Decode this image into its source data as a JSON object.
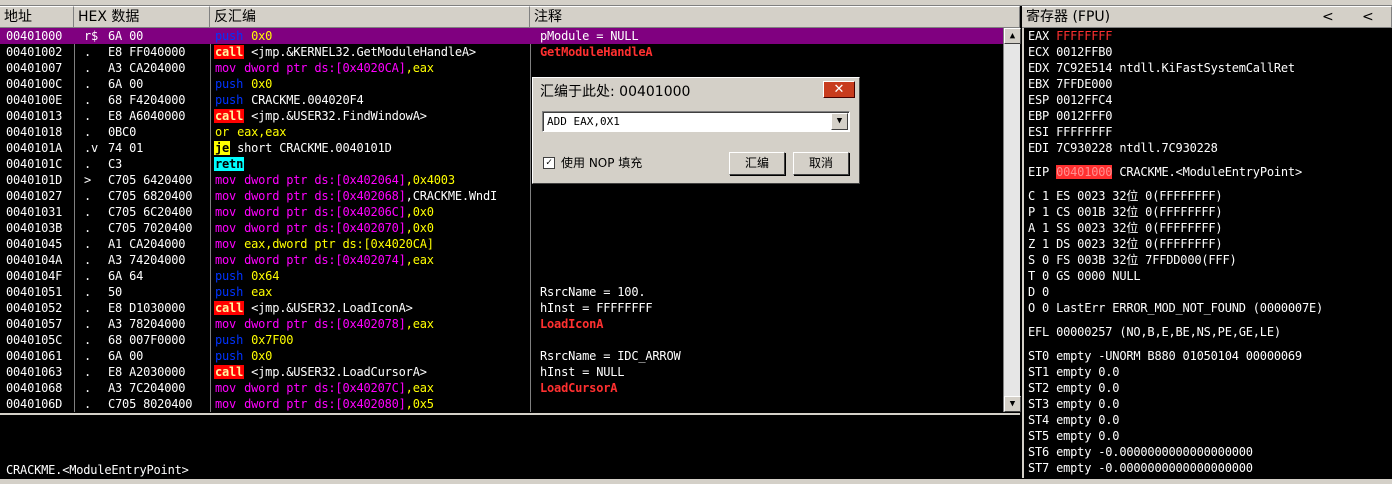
{
  "headers": {
    "address": "地址",
    "hex": "HEX 数据",
    "disasm": "反汇编",
    "comment": "注释",
    "registers": "寄存器 (FPU)",
    "reg_nav_left": "<",
    "reg_nav_right": "<"
  },
  "rows": [
    {
      "addr": "00401000",
      "mark": "r$",
      "hex": "6A 00",
      "asm": [
        {
          "t": "push",
          "c": "mnem-push"
        },
        {
          "t": " 0x0",
          "c": "num"
        }
      ],
      "cmt": "pModule = NULL",
      "sel": true
    },
    {
      "addr": "00401002",
      "mark": ".",
      "hex": "E8 FF040000",
      "asm": [
        {
          "t": "call",
          "c": "k-call"
        },
        {
          "t": " <jmp.&KERNEL32.GetModuleHandleA>",
          "c": "op"
        }
      ],
      "cmt": "GetModuleHandleA",
      "cmtApi": true
    },
    {
      "addr": "00401007",
      "mark": ".",
      "hex": "A3 CA204000",
      "asm": [
        {
          "t": "mov",
          "c": "mnem-mov"
        },
        {
          "t": " dword ptr ds:[0x4020CA]",
          "c": "ptr"
        },
        {
          "t": ",eax",
          "c": "num"
        }
      ],
      "cmt": ""
    },
    {
      "addr": "0040100C",
      "mark": ".",
      "hex": "6A 00",
      "asm": [
        {
          "t": "push",
          "c": "mnem-push"
        },
        {
          "t": " 0x0",
          "c": "num"
        }
      ],
      "cmt": ""
    },
    {
      "addr": "0040100E",
      "mark": ".",
      "hex": "68 F4204000",
      "asm": [
        {
          "t": "push",
          "c": "mnem-push"
        },
        {
          "t": " CRACKME.004020F4",
          "c": "op"
        }
      ],
      "cmt": ""
    },
    {
      "addr": "00401013",
      "mark": ".",
      "hex": "E8 A6040000",
      "asm": [
        {
          "t": "call",
          "c": "k-call"
        },
        {
          "t": " <jmp.&USER32.FindWindowA>",
          "c": "op"
        }
      ],
      "cmt": ""
    },
    {
      "addr": "00401018",
      "mark": ".",
      "hex": "0BC0",
      "asm": [
        {
          "t": "or",
          "c": "mnem-or"
        },
        {
          "t": " eax,eax",
          "c": "num"
        }
      ],
      "cmt": ""
    },
    {
      "addr": "0040101A",
      "mark": ".v",
      "hex": "74 01",
      "asm": [
        {
          "t": "je",
          "c": "k-je"
        },
        {
          "t": " short CRACKME.0040101D",
          "c": "op"
        }
      ],
      "cmt": ""
    },
    {
      "addr": "0040101C",
      "mark": ".",
      "hex": "C3",
      "asm": [
        {
          "t": "retn",
          "c": "k-retn"
        }
      ],
      "cmt": ""
    },
    {
      "addr": "0040101D",
      "mark": ">",
      "hex": "C705 6420400",
      "asm": [
        {
          "t": "mov",
          "c": "mnem-mov"
        },
        {
          "t": " dword ptr ds:[0x402064]",
          "c": "ptr"
        },
        {
          "t": ",0x4003",
          "c": "num"
        }
      ],
      "cmt": ""
    },
    {
      "addr": "00401027",
      "mark": ".",
      "hex": "C705 6820400",
      "asm": [
        {
          "t": "mov",
          "c": "mnem-mov"
        },
        {
          "t": " dword ptr ds:[0x402068]",
          "c": "ptr"
        },
        {
          "t": ",CRACKME.WndI",
          "c": "op"
        }
      ],
      "cmt": ""
    },
    {
      "addr": "00401031",
      "mark": ".",
      "hex": "C705 6C20400",
      "asm": [
        {
          "t": "mov",
          "c": "mnem-mov"
        },
        {
          "t": " dword ptr ds:[0x40206C]",
          "c": "ptr"
        },
        {
          "t": ",0x0",
          "c": "num"
        }
      ],
      "cmt": ""
    },
    {
      "addr": "0040103B",
      "mark": ".",
      "hex": "C705 7020400",
      "asm": [
        {
          "t": "mov",
          "c": "mnem-mov"
        },
        {
          "t": " dword ptr ds:[0x402070]",
          "c": "ptr"
        },
        {
          "t": ",0x0",
          "c": "num"
        }
      ],
      "cmt": ""
    },
    {
      "addr": "00401045",
      "mark": ".",
      "hex": "A1 CA204000",
      "asm": [
        {
          "t": "mov",
          "c": "mnem-mov"
        },
        {
          "t": " eax,dword ptr ds:[0x4020CA]",
          "c": "num"
        }
      ],
      "cmt": ""
    },
    {
      "addr": "0040104A",
      "mark": ".",
      "hex": "A3 74204000",
      "asm": [
        {
          "t": "mov",
          "c": "mnem-mov"
        },
        {
          "t": " dword ptr ds:[0x402074]",
          "c": "ptr"
        },
        {
          "t": ",eax",
          "c": "num"
        }
      ],
      "cmt": ""
    },
    {
      "addr": "0040104F",
      "mark": ".",
      "hex": "6A 64",
      "asm": [
        {
          "t": "push",
          "c": "mnem-push"
        },
        {
          "t": " 0x64",
          "c": "num"
        }
      ],
      "cmt": ""
    },
    {
      "addr": "00401051",
      "mark": ".",
      "hex": "50",
      "asm": [
        {
          "t": "push",
          "c": "mnem-push"
        },
        {
          "t": " eax",
          "c": "num"
        }
      ],
      "cmt": "RsrcName = 100."
    },
    {
      "addr": "00401052",
      "mark": ".",
      "hex": "E8 D1030000",
      "asm": [
        {
          "t": "call",
          "c": "k-call"
        },
        {
          "t": " <jmp.&USER32.LoadIconA>",
          "c": "op"
        }
      ],
      "cmt": "hInst = FFFFFFFF"
    },
    {
      "addr": "00401057",
      "mark": ".",
      "hex": "A3 78204000",
      "asm": [
        {
          "t": "mov",
          "c": "mnem-mov"
        },
        {
          "t": " dword ptr ds:[0x402078]",
          "c": "ptr"
        },
        {
          "t": ",eax",
          "c": "num"
        }
      ],
      "cmt": "LoadIconA",
      "cmtApi": true
    },
    {
      "addr": "0040105C",
      "mark": ".",
      "hex": "68 007F0000",
      "asm": [
        {
          "t": "push",
          "c": "mnem-push"
        },
        {
          "t": " 0x7F00",
          "c": "num"
        }
      ],
      "cmt": ""
    },
    {
      "addr": "00401061",
      "mark": ".",
      "hex": "6A 00",
      "asm": [
        {
          "t": "push",
          "c": "mnem-push"
        },
        {
          "t": " 0x0",
          "c": "num"
        }
      ],
      "cmt": "RsrcName = IDC_ARROW"
    },
    {
      "addr": "00401063",
      "mark": ".",
      "hex": "E8 A2030000",
      "asm": [
        {
          "t": "call",
          "c": "k-call"
        },
        {
          "t": " <jmp.&USER32.LoadCursorA>",
          "c": "op"
        }
      ],
      "cmt": "hInst = NULL"
    },
    {
      "addr": "00401068",
      "mark": ".",
      "hex": "A3 7C204000",
      "asm": [
        {
          "t": "mov",
          "c": "mnem-mov"
        },
        {
          "t": " dword ptr ds:[0x40207C]",
          "c": "ptr"
        },
        {
          "t": ",eax",
          "c": "num"
        }
      ],
      "cmt": "LoadCursorA",
      "cmtApi": true
    },
    {
      "addr": "0040106D",
      "mark": ".",
      "hex": "C705 8020400",
      "asm": [
        {
          "t": "mov",
          "c": "mnem-mov"
        },
        {
          "t": " dword ptr ds:[0x402080]",
          "c": "ptr"
        },
        {
          "t": ",0x5",
          "c": "num"
        }
      ],
      "cmt": ""
    }
  ],
  "info_text": "CRACKME.<ModuleEntryPoint>",
  "registers": [
    {
      "name": "EAX",
      "value": "FFFFFFFF",
      "extra": "",
      "valueRed": true
    },
    {
      "name": "ECX",
      "value": "0012FFB0",
      "extra": ""
    },
    {
      "name": "EDX",
      "value": "7C92E514",
      "extra": "ntdll.KiFastSystemCallRet"
    },
    {
      "name": "EBX",
      "value": "7FFDE000",
      "extra": ""
    },
    {
      "name": "ESP",
      "value": "0012FFC4",
      "extra": ""
    },
    {
      "name": "EBP",
      "value": "0012FFF0",
      "extra": ""
    },
    {
      "name": "ESI",
      "value": "FFFFFFFF",
      "extra": ""
    },
    {
      "name": "EDI",
      "value": "7C930228",
      "extra": "ntdll.7C930228"
    }
  ],
  "eip": {
    "name": "EIP",
    "value": "00401000",
    "extra": "CRACKME.<ModuleEntryPoint>"
  },
  "flags": [
    "C 1   ES 0023 32位  0(FFFFFFFF)",
    "P 1   CS 001B 32位  0(FFFFFFFF)",
    "A 1   SS 0023 32位  0(FFFFFFFF)",
    "Z 1   DS 0023 32位  0(FFFFFFFF)",
    "S 0   FS 003B 32位  7FFDD000(FFF)",
    "T 0   GS 0000 NULL",
    "D 0",
    "O 0   LastErr ERROR_MOD_NOT_FOUND (0000007E)"
  ],
  "efl": "EFL 00000257 (NO,B,E,BE,NS,PE,GE,LE)",
  "fpu": [
    "ST0 empty -UNORM B880 01050104 00000069",
    "ST1 empty 0.0",
    "ST2 empty 0.0",
    "ST3 empty 0.0",
    "ST4 empty 0.0",
    "ST5 empty 0.0",
    "ST6 empty -0.0000000000000000000",
    "ST7 empty -0.0000000000000000000"
  ],
  "dialog": {
    "title": "汇编于此处: 00401000",
    "close": "✕",
    "combo_value": "ADD EAX,0X1",
    "checkbox_label": "使用 NOP 填充",
    "checkbox_mark": "✓",
    "assemble_button": "汇编",
    "cancel_button": "取消"
  },
  "colors": {
    "selection": "#800080",
    "call_bg": "#ff0000",
    "je_bg": "#ffff00",
    "retn_bg": "#00ffff",
    "api_red": "#ff3030",
    "push_blue": "#0033ff",
    "ptr_magenta": "#ff00ff",
    "num_yellow": "#ffff00"
  }
}
